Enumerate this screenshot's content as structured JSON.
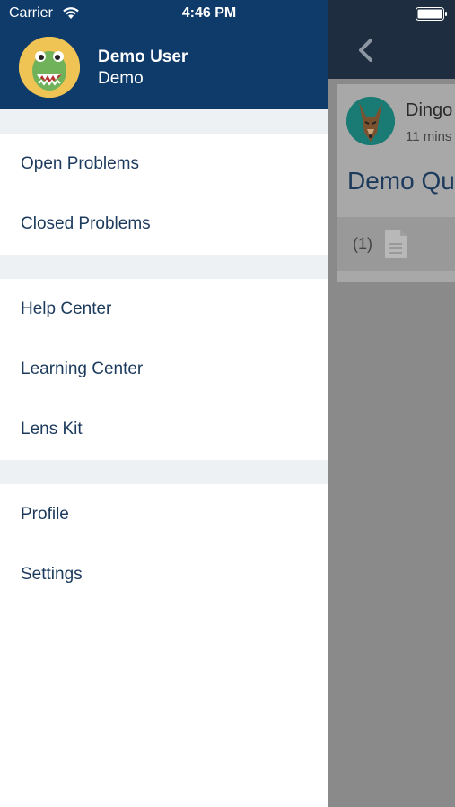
{
  "status_bar": {
    "carrier": "Carrier",
    "time": "4:46 PM"
  },
  "drawer": {
    "user": {
      "name": "Demo User",
      "subtitle": "Demo"
    },
    "sections": [
      {
        "items": [
          "Open Problems",
          "Closed Problems"
        ]
      },
      {
        "items": [
          "Help Center",
          "Learning Center",
          "Lens Kit"
        ]
      },
      {
        "items": [
          "Profile",
          "Settings"
        ]
      }
    ]
  },
  "background": {
    "card": {
      "author": "Dingo",
      "time": "11 mins",
      "title": "Demo Qu",
      "attachment_count": "(1)"
    }
  },
  "colors": {
    "drawer_header": "#0f3b6b",
    "menu_text": "#1b3a5c",
    "divider": "#eef1f3"
  }
}
